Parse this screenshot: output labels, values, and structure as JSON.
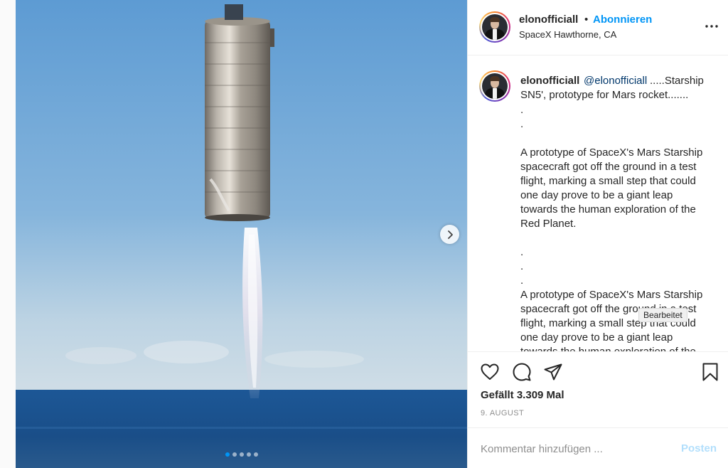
{
  "post": {
    "username": "elonofficiall",
    "separator": "•",
    "follow_label": "Abonnieren",
    "location": "SpaceX Hawthorne, CA",
    "more_icon": "more-options-icon"
  },
  "caption": {
    "author": "elonofficiall",
    "mention": "@elonofficiall",
    "title_part1": ".....Starship",
    "title_part2": "SN5', prototype for Mars rocket.......",
    "lines": [
      ".",
      ".",
      "",
      "A prototype of SpaceX's Mars Starship",
      "spacecraft got off the ground in a test",
      "flight, marking a small step that could",
      "one day prove to be a giant leap",
      "towards the human exploration of the",
      "Red Planet.",
      "",
      ".",
      ".",
      ".",
      "A prototype of SpaceX's Mars Starship",
      "spacecraft got off the ground in a test",
      "flight, marking a small step that could",
      "one day prove to be a giant leap",
      "towards the human exploration of the"
    ]
  },
  "tooltip": "Bearbeitet",
  "actions": {
    "like_icon": "heart-icon",
    "comment_icon": "comment-icon",
    "share_icon": "share-icon",
    "save_icon": "bookmark-icon"
  },
  "likes": "Gefällt 3.309 Mal",
  "date": "9. AUGUST",
  "comment": {
    "placeholder": "Kommentar hinzufügen ...",
    "post_label": "Posten"
  },
  "carousel": {
    "slide_count": 5,
    "active_index": 0,
    "next_icon": "chevron-right-icon"
  },
  "colors": {
    "accent": "#0095f6",
    "mention": "#00376b",
    "muted": "#8e8e8e",
    "post_disabled": "#b2dffc"
  }
}
